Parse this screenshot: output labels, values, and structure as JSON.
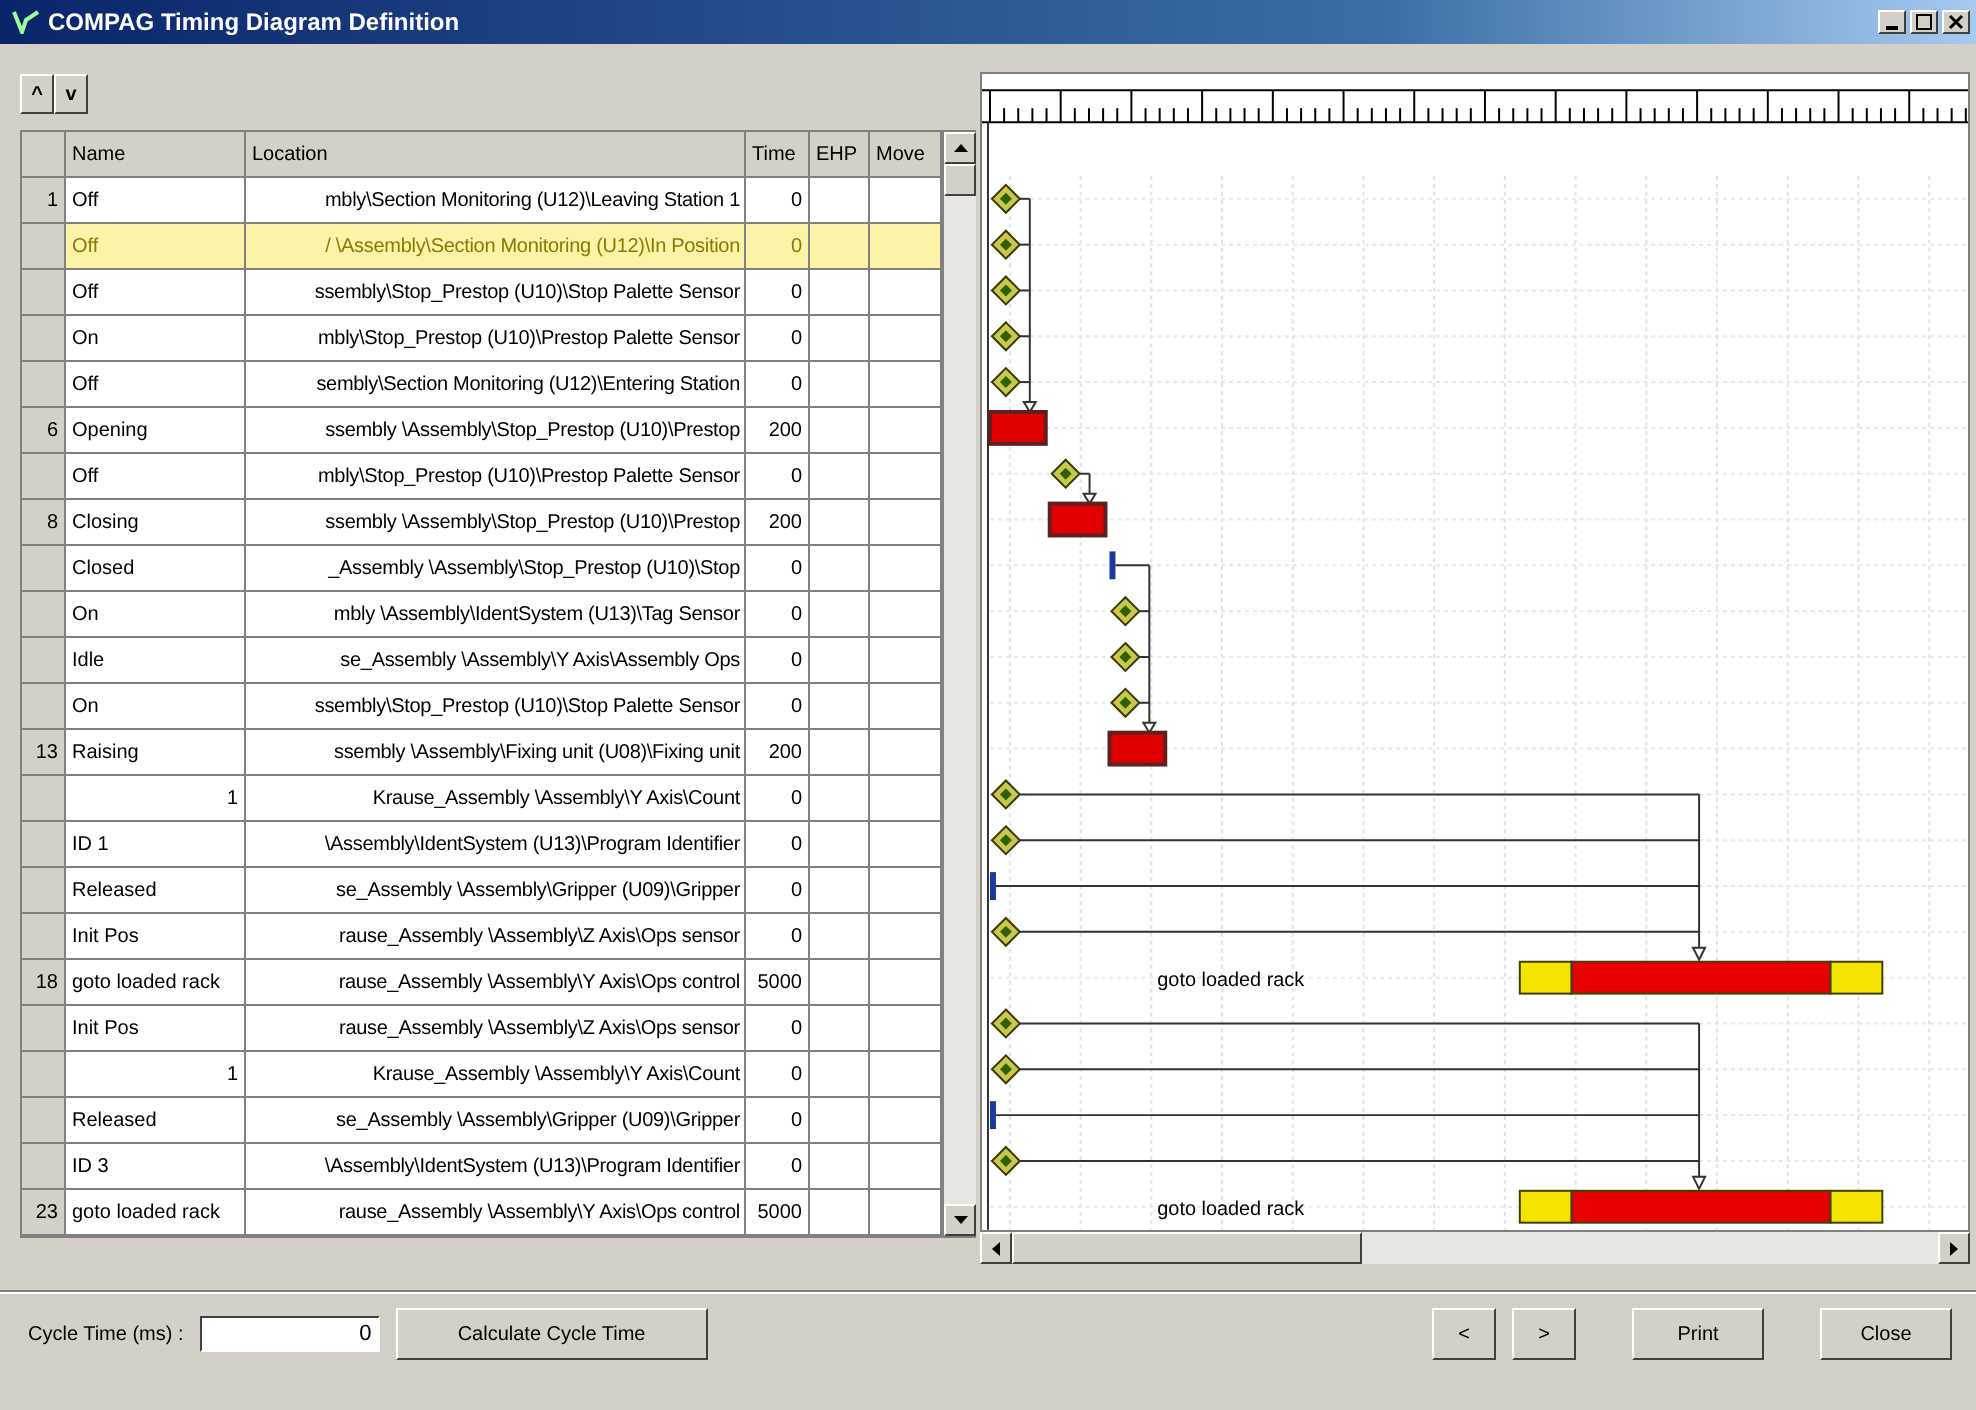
{
  "window": {
    "title": "COMPAG Timing Diagram Definition"
  },
  "toolbar": {
    "buttons": [
      "^",
      "v"
    ]
  },
  "table": {
    "columns": [
      "Name",
      "Location",
      "Time",
      "EHP",
      "Move"
    ],
    "rows": [
      {
        "number": "1",
        "name": "Off",
        "kind": "signal",
        "location": "mbly\\Section Monitoring (U12)\\Leaving Station 1",
        "time": "0",
        "selected": false
      },
      {
        "name": "Off",
        "kind": "signal",
        "location": "/ \\Assembly\\Section Monitoring (U12)\\In Position",
        "time": "0",
        "selected": true
      },
      {
        "name": "Off",
        "kind": "signal",
        "location": "ssembly\\Stop_Prestop (U10)\\Stop Palette Sensor",
        "time": "0",
        "selected": false
      },
      {
        "name": "On",
        "kind": "signal",
        "location": "mbly\\Stop_Prestop (U10)\\Prestop Palette Sensor",
        "time": "0",
        "selected": false
      },
      {
        "name": "Off",
        "kind": "signal",
        "location": "sembly\\Section Monitoring (U12)\\Entering Station",
        "time": "0",
        "selected": false
      },
      {
        "number": "6",
        "name": "Opening",
        "kind": "signal",
        "location": "ssembly \\Assembly\\Stop_Prestop (U10)\\Prestop",
        "time": "200",
        "selected": false
      },
      {
        "name": "Off",
        "kind": "signal",
        "location": "mbly\\Stop_Prestop (U10)\\Prestop Palette Sensor",
        "time": "0",
        "selected": false
      },
      {
        "number": "8",
        "name": "Closing",
        "kind": "signal",
        "location": "ssembly \\Assembly\\Stop_Prestop (U10)\\Prestop",
        "time": "200",
        "selected": false
      },
      {
        "name": "Closed",
        "kind": "signal",
        "location": "_Assembly \\Assembly\\Stop_Prestop (U10)\\Stop",
        "time": "0",
        "selected": false
      },
      {
        "name": "On",
        "kind": "signal",
        "location": "mbly \\Assembly\\IdentSystem (U13)\\Tag Sensor",
        "time": "0",
        "selected": false
      },
      {
        "name": "Idle",
        "kind": "signal",
        "location": "se_Assembly \\Assembly\\Y Axis\\Assembly Ops",
        "time": "0",
        "selected": false
      },
      {
        "name": "On",
        "kind": "signal",
        "location": "ssembly\\Stop_Prestop (U10)\\Stop Palette Sensor",
        "time": "0",
        "selected": false
      },
      {
        "number": "13",
        "name": "Raising",
        "kind": "signal",
        "location": "ssembly \\Assembly\\Fixing unit (U08)\\Fixing unit",
        "time": "200",
        "selected": false
      },
      {
        "name": "1",
        "kind": "counter",
        "location": "Krause_Assembly \\Assembly\\Y Axis\\Count",
        "time": "0",
        "selected": false
      },
      {
        "name": "ID 1",
        "kind": "signal",
        "location": "\\Assembly\\IdentSystem (U13)\\Program Identifier",
        "time": "0",
        "selected": false
      },
      {
        "name": "Released",
        "kind": "signal",
        "location": "se_Assembly \\Assembly\\Gripper (U09)\\Gripper",
        "time": "0",
        "selected": false
      },
      {
        "name": "Init Pos",
        "kind": "signal",
        "location": "rause_Assembly \\Assembly\\Z Axis\\Ops sensor",
        "time": "0",
        "selected": false
      },
      {
        "number": "18",
        "name": "goto loaded rack",
        "kind": "signal",
        "location": "rause_Assembly \\Assembly\\Y Axis\\Ops control",
        "time": "5000",
        "selected": false
      },
      {
        "name": "Init Pos",
        "kind": "signal",
        "location": "rause_Assembly \\Assembly\\Z Axis\\Ops sensor",
        "time": "0",
        "selected": false
      },
      {
        "name": "1",
        "kind": "counter",
        "location": "Krause_Assembly \\Assembly\\Y Axis\\Count",
        "time": "0",
        "selected": false
      },
      {
        "name": "Released",
        "kind": "signal",
        "location": "se_Assembly \\Assembly\\Gripper (U09)\\Gripper",
        "time": "0",
        "selected": false
      },
      {
        "name": "ID 3",
        "kind": "signal",
        "location": "\\Assembly\\IdentSystem (U13)\\Program Identifier",
        "time": "0",
        "selected": false
      },
      {
        "number": "23",
        "name": "goto loaded rack",
        "kind": "signal",
        "location": "rause_Assembly \\Assembly\\Y Axis\\Ops control",
        "time": "5000",
        "selected": false
      }
    ]
  },
  "diagram": {
    "sequences": [
      {
        "items": [
          {
            "kind": "event"
          },
          {
            "kind": "event"
          },
          {
            "kind": "event"
          },
          {
            "kind": "event"
          },
          {
            "kind": "event"
          },
          {
            "kind": "action"
          },
          {
            "kind": "event"
          },
          {
            "kind": "action"
          },
          {
            "kind": "marker"
          },
          {
            "kind": "event"
          },
          {
            "kind": "event"
          },
          {
            "kind": "event"
          },
          {
            "kind": "action"
          }
        ]
      },
      {
        "items": [
          {
            "kind": "event"
          },
          {
            "kind": "event"
          },
          {
            "kind": "marker"
          },
          {
            "kind": "event"
          },
          {
            "kind": "long_action",
            "label": "goto loaded rack"
          }
        ]
      },
      {
        "items": [
          {
            "kind": "event"
          },
          {
            "kind": "event"
          },
          {
            "kind": "marker"
          },
          {
            "kind": "event"
          },
          {
            "kind": "long_action",
            "label": "goto loaded rack"
          }
        ]
      }
    ]
  },
  "footer": {
    "cycle_time_label": "Cycle Time (ms) :",
    "cycle_time_value": "0",
    "calculate_button": "Calculate Cycle Time",
    "nav_buttons": [
      "<",
      ">"
    ],
    "buttons": [
      "Print",
      "Close"
    ]
  }
}
